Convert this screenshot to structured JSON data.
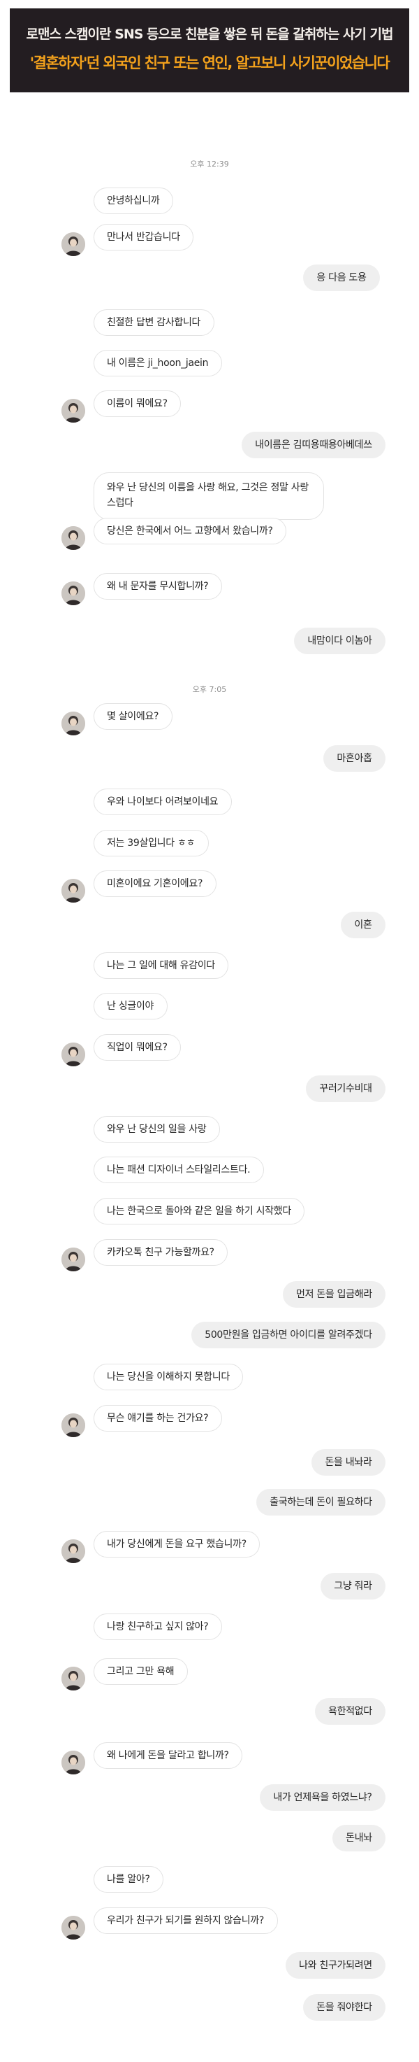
{
  "banner": {
    "line1": "로맨스 스캠이란 SNS 등으로 친분을 쌓은 뒤 돈을 갈취하는 사기 기법",
    "line2": "'결혼하자'던 외국인 친구 또는 연인, 알고보니 사기꾼이었습니다"
  },
  "timestamps": [
    "오후 12:39",
    "오후 7:05"
  ],
  "messages": [
    {
      "from": "them",
      "text": "안녕하십니까"
    },
    {
      "from": "them",
      "text": "만나서 반갑습니다",
      "avatar": true
    },
    {
      "from": "me",
      "text": "응 다음 도용"
    },
    {
      "from": "them",
      "text": "친절한 답변 감사합니다"
    },
    {
      "from": "them",
      "text": "내 이름은 ji_hoon_jaein"
    },
    {
      "from": "them",
      "text": "이름이 뭐에요?",
      "avatar": true
    },
    {
      "from": "me",
      "text": "내이름은 김띠용때용아베데쓰"
    },
    {
      "from": "them",
      "text": "와우 난 당신의 이름을 사랑 해요, 그것은 정말 사랑 스럽다"
    },
    {
      "from": "them",
      "text": "당신은 한국에서 어느 고향에서 왔습니까?",
      "avatar": true
    },
    {
      "from": "them",
      "text": "왜 내 문자를 무시합니까?",
      "avatar": true
    },
    {
      "from": "me",
      "text": "내맘이다 이놈아"
    },
    {
      "from": "them",
      "text": "몇 살이에요?",
      "avatar": true
    },
    {
      "from": "me",
      "text": "마흔아홉"
    },
    {
      "from": "them",
      "text": "우와 나이보다 어려보이네요"
    },
    {
      "from": "them",
      "text": "저는 39살입니다 ㅎㅎ"
    },
    {
      "from": "them",
      "text": "미혼이에요 기혼이에요?",
      "avatar": true
    },
    {
      "from": "me",
      "text": "이혼"
    },
    {
      "from": "them",
      "text": "나는 그 일에 대해 유감이다"
    },
    {
      "from": "them",
      "text": "난 싱글이야"
    },
    {
      "from": "them",
      "text": "직업이 뭐에요?",
      "avatar": true
    },
    {
      "from": "me",
      "text": "꾸러기수비대"
    },
    {
      "from": "them",
      "text": "와우 난 당신의 일을 사랑"
    },
    {
      "from": "them",
      "text": "나는 패션 디자이너 스타일리스트다."
    },
    {
      "from": "them",
      "text": "나는 한국으로 돌아와 같은 일을 하기 시작했다"
    },
    {
      "from": "them",
      "text": "카카오톡 친구 가능할까요?",
      "avatar": true
    },
    {
      "from": "me",
      "text": "먼저 돈을 입금해라"
    },
    {
      "from": "me",
      "text": "500만원을 입금하면 아이디를 알려주겠다"
    },
    {
      "from": "them",
      "text": "나는 당신을 이해하지 못합니다"
    },
    {
      "from": "them",
      "text": "무슨 얘기를 하는 건가요?",
      "avatar": true
    },
    {
      "from": "me",
      "text": "돈을 내놔라"
    },
    {
      "from": "me",
      "text": "출국하는데 돈이 필요하다"
    },
    {
      "from": "them",
      "text": "내가 당신에게 돈을 요구 했습니까?",
      "avatar": true
    },
    {
      "from": "me",
      "text": "그냥 줘라"
    },
    {
      "from": "them",
      "text": "나랑 친구하고 싶지 않아?"
    },
    {
      "from": "them",
      "text": "그리고 그만 욕해",
      "avatar": true
    },
    {
      "from": "me",
      "text": "욕한적없다"
    },
    {
      "from": "them",
      "text": "왜 나에게 돈을 달라고 합니까?",
      "avatar": true
    },
    {
      "from": "me",
      "text": "내가 언제욕을 하였느냐?"
    },
    {
      "from": "me",
      "text": "돈내놔"
    },
    {
      "from": "them",
      "text": "나를 알아?"
    },
    {
      "from": "them",
      "text": "우리가 친구가 되기를 원하지 않습니까?",
      "avatar": true
    },
    {
      "from": "me",
      "text": "나와 친구가되려면"
    },
    {
      "from": "me",
      "text": "돈을 줘야한다"
    }
  ]
}
